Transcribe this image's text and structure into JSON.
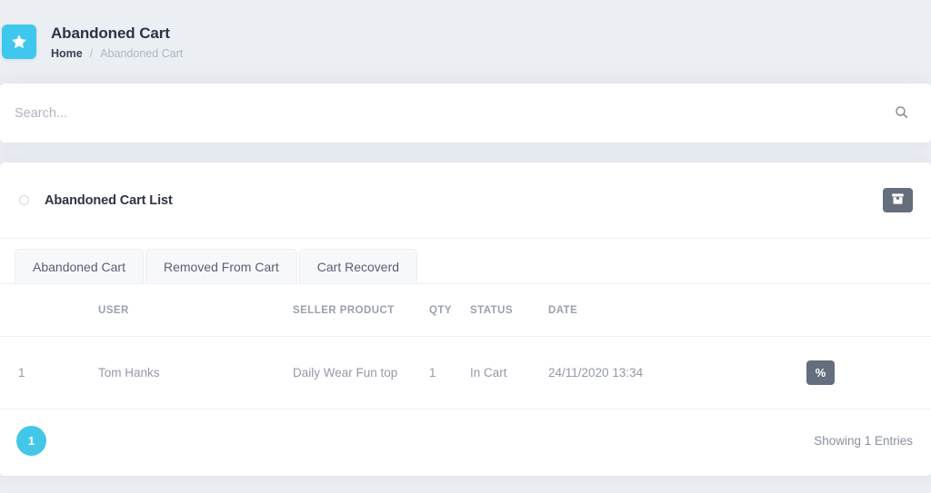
{
  "header": {
    "brand_icon": "star-icon",
    "title": "Abandoned Cart",
    "breadcrumb": {
      "home": "Home",
      "separator": "/",
      "current": "Abandoned Cart"
    },
    "accent_color": "#3fc8ee",
    "background_color": "#ebeef3"
  },
  "search": {
    "value": "",
    "placeholder": "Search...",
    "icon": "search-icon"
  },
  "card": {
    "title": "Abandoned Cart List",
    "bullet_icon": "circle-icon",
    "action_button_icon": "archive-box-icon",
    "action_button_color": "#646e7d"
  },
  "tabs": [
    {
      "label": "Abandoned Cart",
      "active": true
    },
    {
      "label": "Removed From Cart",
      "active": false
    },
    {
      "label": "Cart Recoverd",
      "active": false
    }
  ],
  "table": {
    "columns": [
      "",
      "USER",
      "SELLER PRODUCT",
      "QTY",
      "STATUS",
      "DATE",
      ""
    ],
    "rows": [
      {
        "index": "1",
        "user": "Tom Hanks",
        "seller_product": "Daily Wear Fun top",
        "qty": "1",
        "status": "In Cart",
        "date": "24/11/2020 13:34",
        "action_icon": "percent-icon",
        "action_label": "%"
      }
    ]
  },
  "footer": {
    "pagination": {
      "pages": [
        "1"
      ],
      "active_page": "1",
      "active_color": "#42c7e8"
    },
    "entries_text": "Showing 1 Entries"
  }
}
